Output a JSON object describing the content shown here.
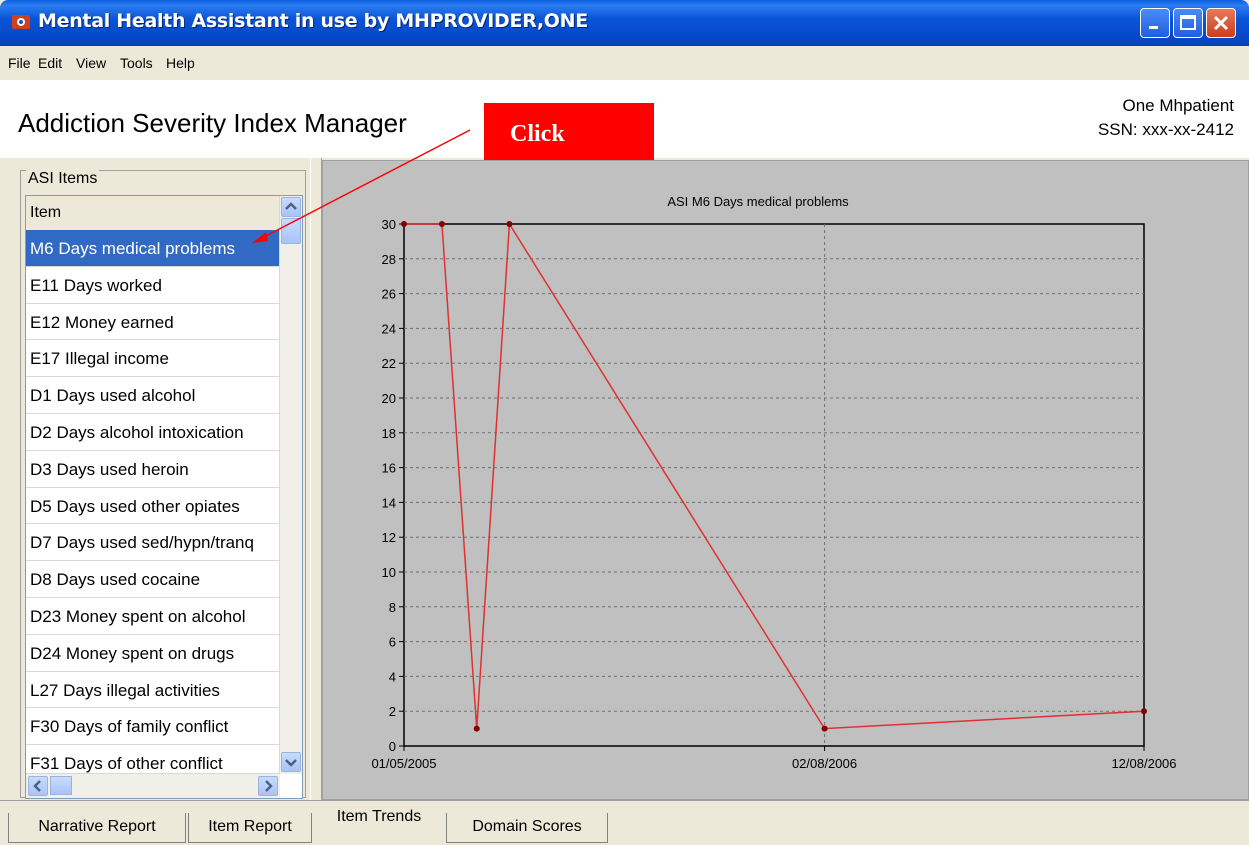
{
  "window": {
    "title": "Mental Health Assistant in use by MHPROVIDER,ONE"
  },
  "menu": [
    "File",
    "Edit",
    "View",
    "Tools",
    "Help"
  ],
  "header": {
    "title": "Addiction Severity Index Manager",
    "patient_name": "One Mhpatient",
    "patient_ssn": "SSN: xxx-xx-2412"
  },
  "annotation": {
    "label": "Click",
    "color": "#ff0000"
  },
  "asi_panel": {
    "group_label": "ASI Items",
    "column_header": "Item",
    "items": [
      "M6 Days medical problems",
      "E11 Days worked",
      "E12 Money earned",
      "E17 Illegal income",
      "D1 Days used alcohol",
      "D2 Days alcohol intoxication",
      "D3 Days used heroin",
      "D5 Days used other opiates",
      "D7 Days used sed/hypn/tranq",
      "D8 Days used cocaine",
      "D23 Money spent on alcohol",
      "D24 Money spent on drugs",
      "L27 Days illegal activities",
      "F30 Days of family conflict",
      "F31 Days of other conflict"
    ],
    "selected_index": 0
  },
  "tabs": {
    "items": [
      "Narrative Report",
      "Item Report",
      "Item Trends",
      "Domain Scores"
    ],
    "active": "Item Trends"
  },
  "chart_data": {
    "type": "line",
    "title": "ASI M6 Days medical problems",
    "xlabel": "",
    "ylabel": "",
    "x_tick_labels": [
      "01/05/2005",
      "02/08/2006",
      "12/08/2006"
    ],
    "x_range": [
      "2005-01-05",
      "2006-12-08"
    ],
    "ylim": [
      0,
      30
    ],
    "y_ticks": [
      0,
      2,
      4,
      6,
      8,
      10,
      12,
      14,
      16,
      18,
      20,
      22,
      24,
      26,
      28,
      30
    ],
    "grid": true,
    "line_color": "#e03030",
    "point_color": "#800000",
    "plot_background": "#c0c0c0",
    "series": [
      {
        "points": [
          {
            "x": "2005-01-05",
            "y": 30
          },
          {
            "x": "2005-02-10",
            "y": 30
          },
          {
            "x": "2005-03-15",
            "y": 1
          },
          {
            "x": "2005-04-15",
            "y": 30
          },
          {
            "x": "2006-02-08",
            "y": 1
          },
          {
            "x": "2006-12-08",
            "y": 2
          }
        ]
      }
    ]
  }
}
